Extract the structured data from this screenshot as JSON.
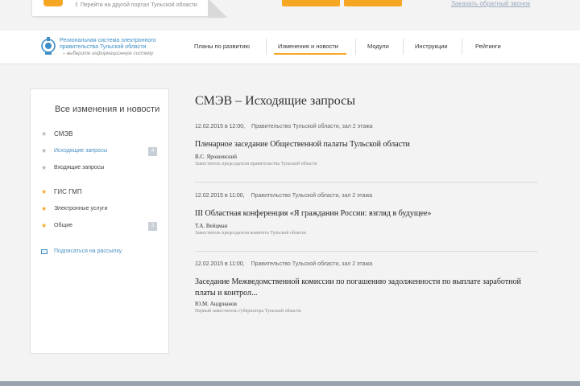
{
  "topbar": {
    "portal_link": "Перейти на другой портал Тульской области",
    "callback_link": "Заказать обратный звонок"
  },
  "logo": {
    "line1": "Региональная система электронного",
    "line2": "правительства Тульской области",
    "tagline": "– выберите информационную систему"
  },
  "nav": [
    {
      "label": "Планы по развитию"
    },
    {
      "label": "Изменения и новости"
    },
    {
      "label": "Модули"
    },
    {
      "label": "Инструкции"
    },
    {
      "label": "Рейтинги"
    }
  ],
  "sidebar": {
    "title": "Все изменения и новости",
    "items": [
      {
        "label": "СМЭВ",
        "badge": ""
      },
      {
        "label": "Исходящие запросы",
        "badge": "4"
      },
      {
        "label": "Входящие запросы",
        "badge": ""
      },
      {
        "label": "ГИС ГМП",
        "badge": ""
      },
      {
        "label": "Электронные услуги",
        "badge": ""
      },
      {
        "label": "Общие",
        "badge": "3"
      }
    ],
    "subscribe": "Подписаться на рассылку",
    "colors": {
      "gray_star": "#b5b5b5",
      "orange_star": "#f5a623",
      "active": "#4a90c2"
    }
  },
  "main": {
    "title": "СМЭВ – Исходящие запросы",
    "news": [
      {
        "date": "12.02.2015 в 12:00,",
        "location": "Правительство Тульской области, зал 2 этажа",
        "title": "Пленарное заседание Общественной палаты Тульской области",
        "author": "В.С. Ярошевский",
        "position": "Заместитель председателя правительства Тульской области"
      },
      {
        "date": "12.02.2015 в 11:00,",
        "location": "Правительство Тульской области, зал 2 этажа",
        "title": "III Областная конференция «Я гражданин России: взгляд в будущее»",
        "author": "Т.А. Вейцман",
        "position": "Заместитель председателя комитета Тульской области"
      },
      {
        "date": "12.02.2015 в 11:00,",
        "location": "Правительство Тульской области, зал 2 этажа",
        "title": "Заседание Межведомственной комиссии по погашению задолженности по выплате заработной платы и контрол...",
        "author": "Ю.М. Андрианов",
        "position": "Первый заместитель губернатора Тульской области"
      }
    ]
  }
}
